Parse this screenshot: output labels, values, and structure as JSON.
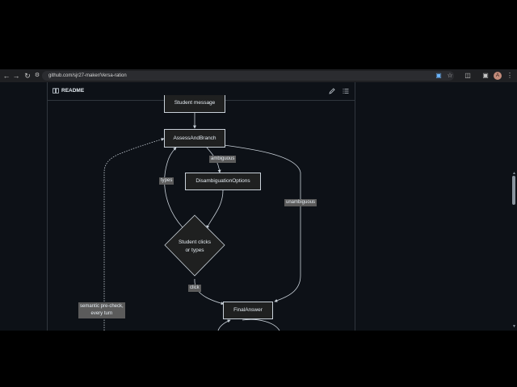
{
  "browser": {
    "url": "github.com/sjr27-maker/Versa-ration",
    "back_icon": "arrow-left-icon",
    "forward_icon": "arrow-right-icon",
    "reload_icon": "reload-icon",
    "avatar_initial": "A"
  },
  "readme": {
    "title": "README",
    "edit_icon": "pencil-icon",
    "outline_icon": "list-icon"
  },
  "diagram": {
    "nodes": {
      "student_message": "Student message",
      "assess_and_branch": "AssessAndBranch",
      "disambiguation_options": "DisambiguationOptions",
      "decision_line1": "Student clicks",
      "decision_line2": "or types",
      "final_answer": "FinalAnswer"
    },
    "edge_labels": {
      "ambiguous": "ambiguous",
      "types": "types",
      "unambiguous": "unambiguous",
      "click": "click",
      "precheck_line1": "semantic pre-check,",
      "precheck_line2": "every turn"
    }
  },
  "colors": {
    "page_bg": "#0d1117",
    "chrome_bg": "#1f2023",
    "node_fill": "#1f2020",
    "edge_label_bg": "#5b5b5b",
    "line": "#c9d1d9"
  }
}
